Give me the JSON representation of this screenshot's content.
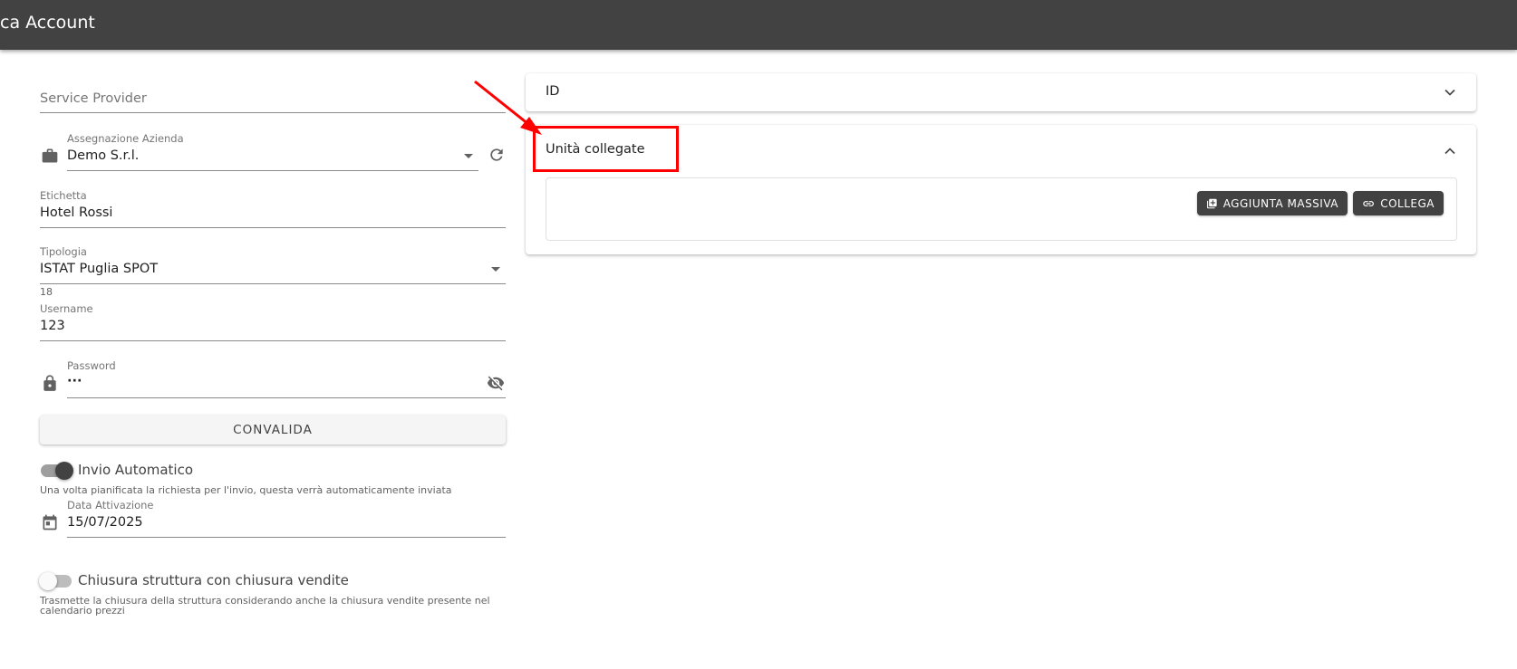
{
  "header": {
    "title": "ca Account"
  },
  "form": {
    "service_provider": {
      "placeholder": "Service Provider"
    },
    "company": {
      "label": "Assegnazione Azienda",
      "value": "Demo S.r.l."
    },
    "etichetta": {
      "label": "Etichetta",
      "value": "Hotel Rossi"
    },
    "tipologia": {
      "label": "Tipologia",
      "value": "ISTAT Puglia SPOT",
      "hint": "18"
    },
    "username": {
      "label": "Username",
      "value": "123"
    },
    "password": {
      "label": "Password",
      "value": "···"
    },
    "validate_button": "CONVALIDA",
    "auto_send": {
      "label": "Invio Automatico",
      "enabled": true,
      "hint": "Una volta pianificata la richiesta per l'invio, questa verrà automaticamente inviata"
    },
    "activation_date": {
      "label": "Data Attivazione",
      "value": "15/07/2025"
    },
    "closure": {
      "label": "Chiusura struttura con chiusura vendite",
      "enabled": false,
      "hint_line1": "Trasmette la chiusura della struttura considerando anche la chiusura vendite presente nel",
      "hint_line2": "calendario prezzi"
    }
  },
  "panels": {
    "id_panel": {
      "title": "ID",
      "expanded": false
    },
    "units_panel": {
      "title": "Unità collegate",
      "expanded": true,
      "bulk_add_button": "AGGIUNTA MASSIVA",
      "link_button": "COLLEGA"
    }
  },
  "icons": {
    "company": "briefcase-icon",
    "refresh": "refresh-icon",
    "password": "lock-icon",
    "visibility": "eye-off-icon",
    "calendar": "calendar-icon",
    "bulk_add": "library-add-icon",
    "link": "link-icon",
    "expand": "chevron-down-icon",
    "collapse": "chevron-up-icon"
  },
  "colors": {
    "header_bg": "#424242",
    "dark_button": "#424242",
    "annotation": "#ff0000"
  }
}
